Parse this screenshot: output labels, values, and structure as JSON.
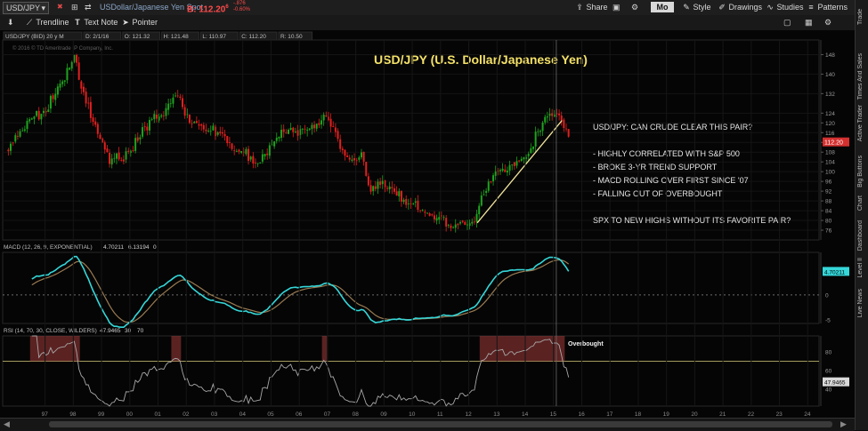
{
  "topbar": {
    "symbol": "USD/JPY",
    "description": "USDollar/Japanese Yen Spot",
    "bid_label": "B: 112.20",
    "bid_fraction": "6",
    "change_abs": "-.876",
    "change_pct": "-0.60%",
    "buttons": [
      "Share",
      "Mo",
      "Style",
      "Drawings",
      "Studies",
      "Patterns"
    ]
  },
  "toolbar": {
    "tools": [
      "Trendline",
      "Text Note",
      "Pointer"
    ]
  },
  "sidebar": {
    "tabs": [
      "Trade",
      "Times And Sales",
      "Active Trader",
      "Big Buttons",
      "Chart",
      "Dashboard",
      "Level II",
      "Live News"
    ]
  },
  "colors": {
    "up_candle": "#1fa31f",
    "down_candle": "#e0201f",
    "macd_line": "#35d7d9",
    "macd_signal": "#9a7b52",
    "trendline": "#f0e39a",
    "title": "#f4e168",
    "overbought_box": "#a23a3a",
    "price_tag": "#d43030"
  },
  "chart_data": [
    {
      "type": "candlestick",
      "header": {
        "symbol_period": "USD/JPY (BID) 20 y M",
        "date": "D: 2/1/16",
        "open": "O: 121.32",
        "high": "H: 121.48",
        "low": "L: 110.97",
        "close": "C: 112.20",
        "range": "R: 10.50"
      },
      "copyright": "© 2016 © TD Ameritrade IP Company, Inc.",
      "title": "USD/JPY (U.S. Dollar/Japanese Yen)",
      "annotation_lines": [
        "USD/JPY: CAN CRUDE CLEAR THIS PAIR?",
        "",
        "- HIGHLY CORRELATED WITH S&P 500",
        "- BROKE 3-YR TREND SUPPORT",
        "- MACD ROLLING OVER FIRST SINCE '07",
        "- FALLING OUT OF OVERBOUGHT",
        "",
        "SPX TO NEW HIGHS WITHOUT ITS FAVORITE PAIR?"
      ],
      "ylim": [
        72,
        154
      ],
      "y_ticks": [
        76,
        80,
        84,
        88,
        92,
        96,
        100,
        104,
        108,
        112,
        116,
        120,
        124,
        132,
        140,
        148
      ],
      "last_price_label": "112.20",
      "x": [
        1996.2,
        1996.6,
        1997.0,
        1997.4,
        1997.8,
        1998.2,
        1998.55,
        1998.9,
        1999.3,
        1999.8,
        2000.3,
        2000.8,
        2001.3,
        2001.8,
        2002.15,
        2002.6,
        2003.1,
        2003.6,
        2004.1,
        2004.6,
        2005.0,
        2005.5,
        2005.9,
        2006.3,
        2006.8,
        2007.2,
        2007.5,
        2007.9,
        2008.3,
        2008.7,
        2009.0,
        2009.5,
        2010.0,
        2010.5,
        2011.0,
        2011.5,
        2011.9,
        2012.3,
        2012.7,
        2013.0,
        2013.4,
        2014.0,
        2014.6,
        2015.0,
        2015.4,
        2015.8,
        2016.1
      ],
      "close": [
        109,
        116,
        121,
        124,
        130,
        138,
        147,
        130,
        118,
        104,
        107,
        114,
        122,
        125,
        132,
        121,
        118,
        117,
        110,
        108,
        103,
        110,
        117,
        116,
        118,
        119,
        124,
        112,
        104,
        106,
        92,
        96,
        91,
        86,
        83,
        81,
        77.5,
        78.5,
        79,
        91,
        98,
        102,
        106,
        119,
        124,
        122,
        112.2
      ],
      "trendline": {
        "x": [
          2012.8,
          2015.8
        ],
        "y": [
          79,
          121
        ]
      },
      "cursor_x": 2015.6
    },
    {
      "type": "line",
      "header": "MACD (12, 26, 9, EXPONENTIAL)",
      "header_values": [
        "4.70211",
        "6.13194",
        "0"
      ],
      "series": [],
      "macd_scale": [
        -5.7,
        8.5
      ],
      "macd_ticks": [
        5,
        0,
        -5
      ],
      "last_value_label": "4.70211"
    },
    {
      "type": "line",
      "header": "RSI (14, 70, 30, CLOSE, WILDERS)",
      "header_values": [
        "47.9465",
        "30",
        "70"
      ],
      "ylim": [
        22,
        97
      ],
      "y_ticks": [
        80,
        60,
        40
      ],
      "overbought_level": 70,
      "overbought_label": "Overbought",
      "last_value_label": "47.9465"
    }
  ],
  "x_axis_labels": [
    "97",
    "98",
    "99",
    "00",
    "01",
    "02",
    "03",
    "04",
    "05",
    "06",
    "07",
    "08",
    "09",
    "10",
    "11",
    "12",
    "13",
    "14",
    "15",
    "16",
    "17",
    "18",
    "19",
    "20",
    "21",
    "22",
    "23",
    "24"
  ]
}
